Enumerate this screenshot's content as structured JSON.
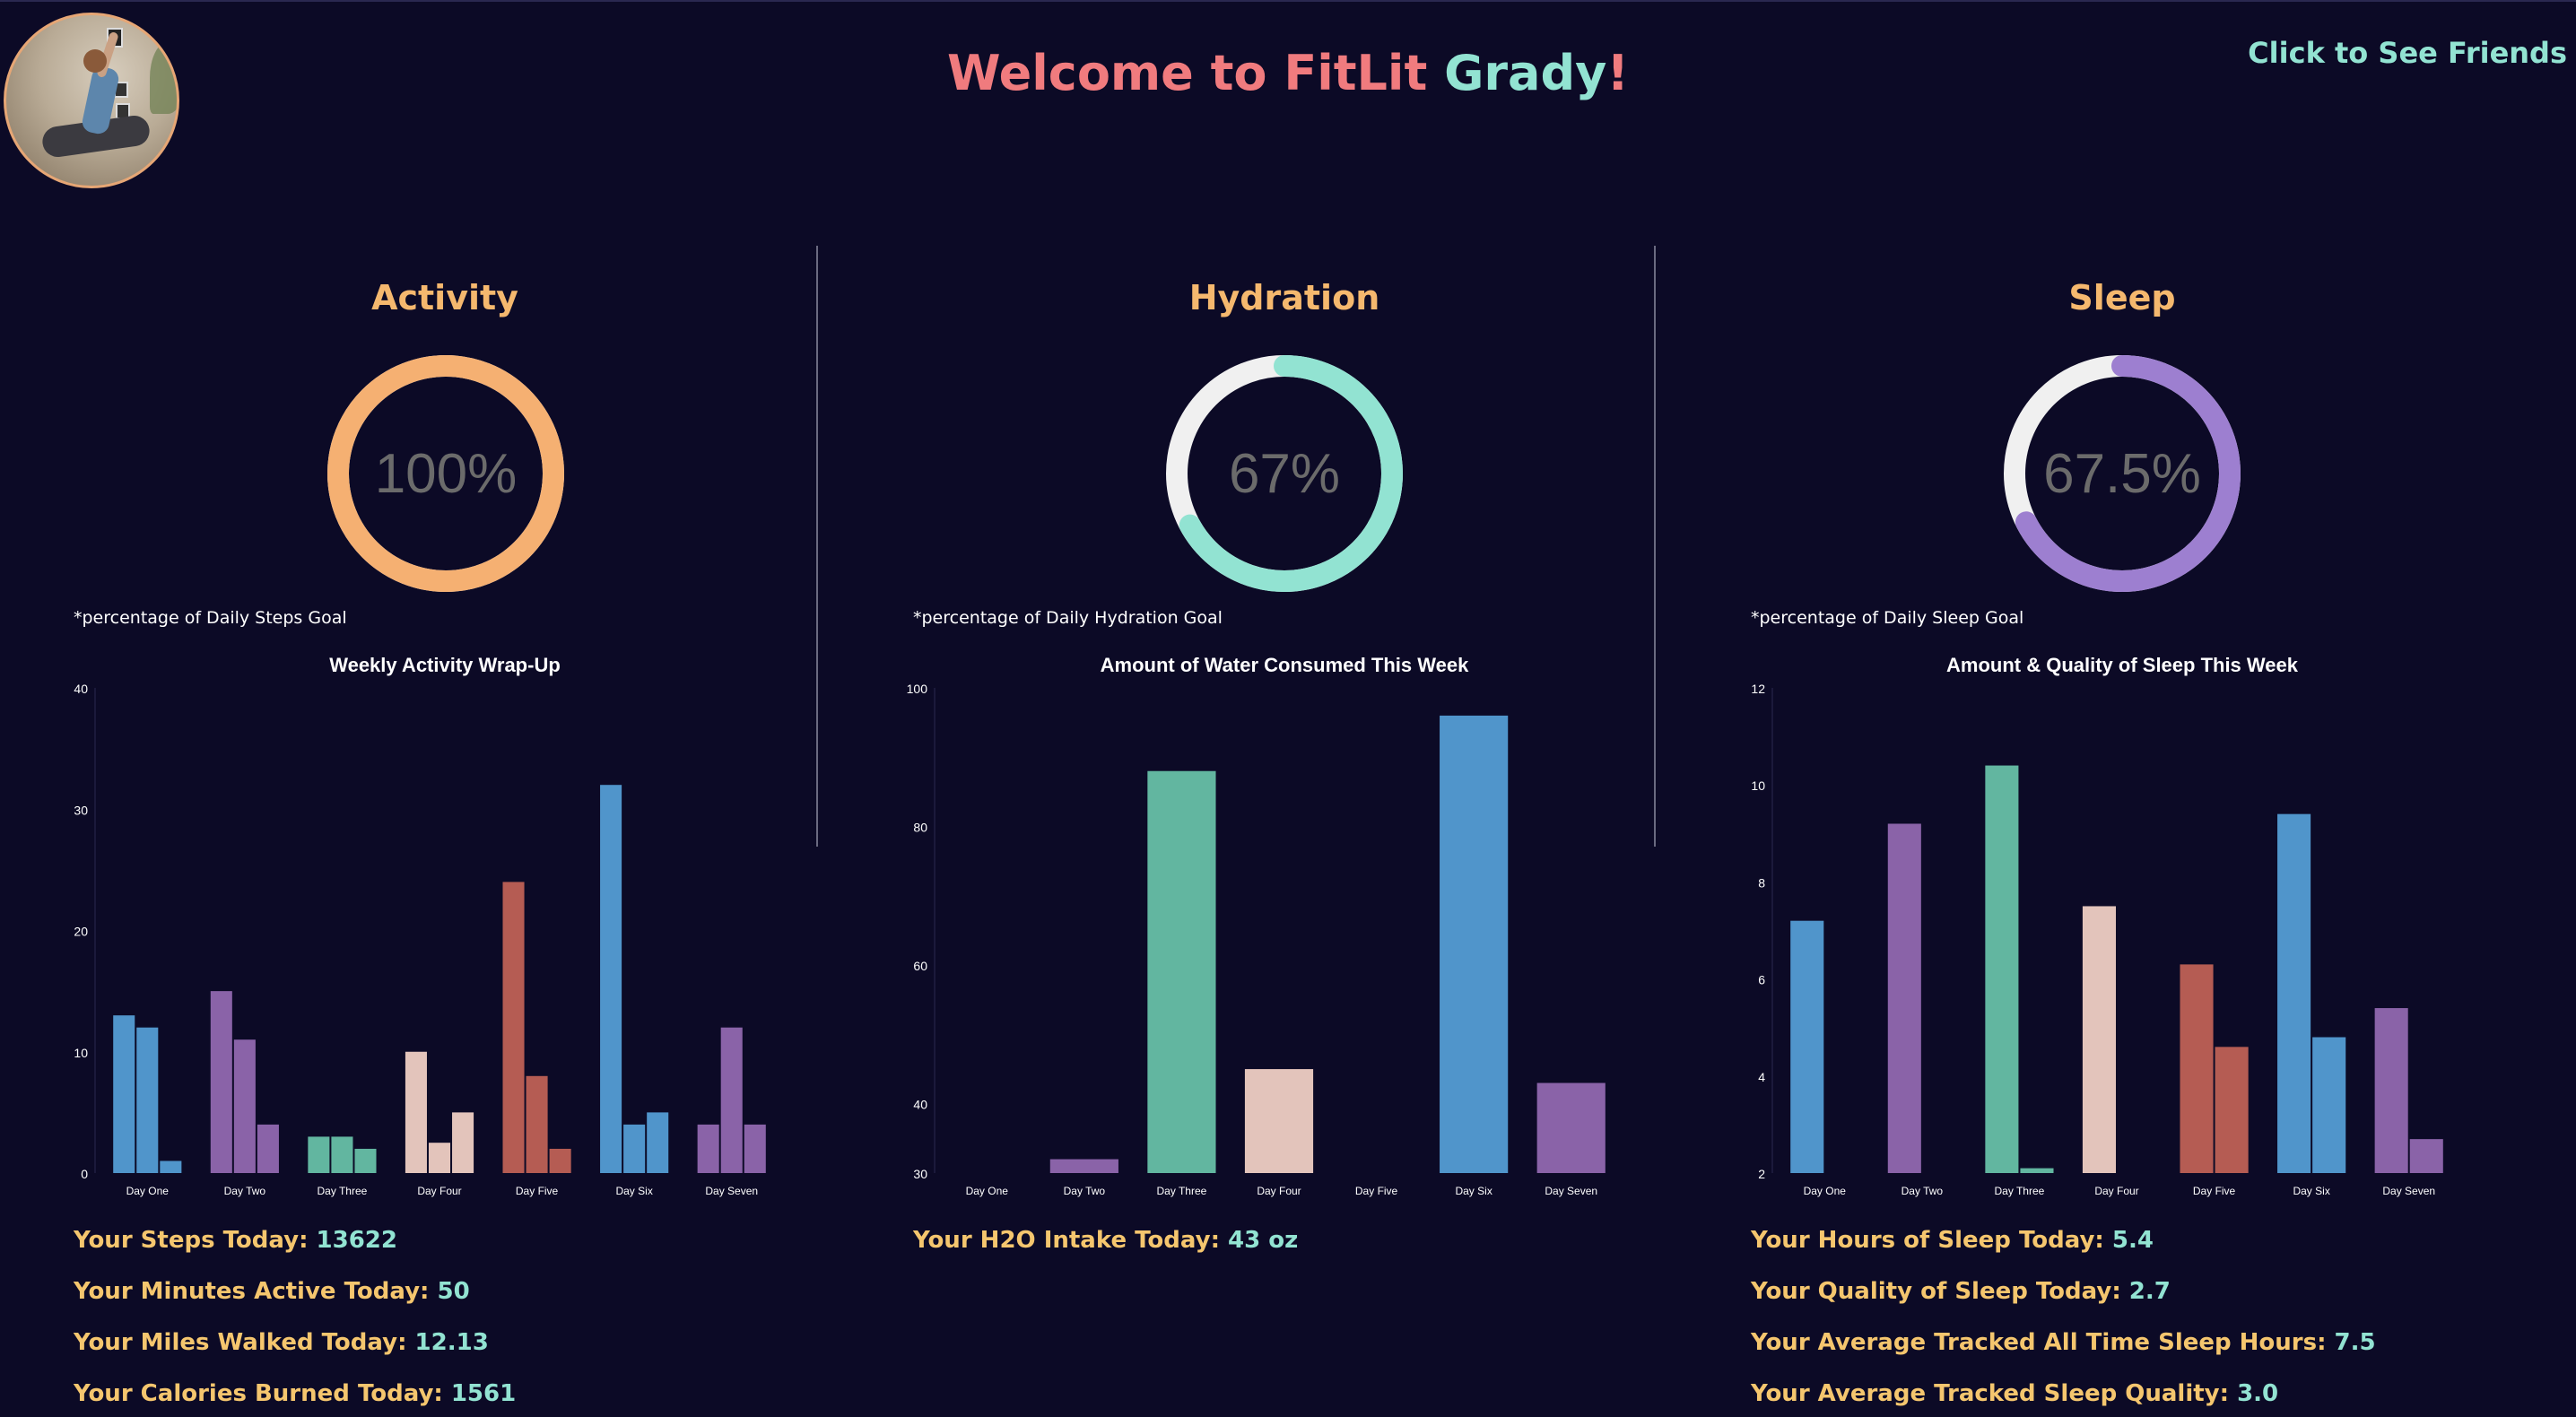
{
  "header": {
    "title_prefix": "Welcome to FitLit ",
    "user_name": "Grady",
    "title_suffix": "!",
    "friends_link": "Click to See Friends"
  },
  "colors": {
    "background": "#0c0a26",
    "title_welcome": "#f07b7e",
    "accent_teal": "#92e3d2",
    "section_title": "#f5b86e",
    "stat_label": "#f5c66e",
    "activity_ring": "#f5b072",
    "hydration_ring": "#92e3d2",
    "sleep_ring": "#9d7fd0",
    "ring_track": "#f0f0f0"
  },
  "sections": {
    "activity": {
      "title": "Activity",
      "percent_label": "100%",
      "percent_value": 100,
      "note": "*percentage of Daily Steps Goal"
    },
    "hydration": {
      "title": "Hydration",
      "percent_label": "67%",
      "percent_value": 67,
      "note": "*percentage of Daily Hydration Goal"
    },
    "sleep": {
      "title": "Sleep",
      "percent_label": "67.5%",
      "percent_value": 67.5,
      "note": "*percentage of Daily Sleep Goal"
    }
  },
  "stats": {
    "activity": [
      {
        "label": "Your Steps Today: ",
        "value": "13622"
      },
      {
        "label": "Your Minutes Active Today: ",
        "value": "50"
      },
      {
        "label": "Your Miles Walked Today: ",
        "value": "12.13"
      },
      {
        "label": "Your Calories Burned Today: ",
        "value": "1561"
      }
    ],
    "hydration": [
      {
        "label": "Your H2O Intake Today: ",
        "value": "43 oz"
      }
    ],
    "sleep": [
      {
        "label": "Your Hours of Sleep Today: ",
        "value": "5.4"
      },
      {
        "label": "Your Quality of Sleep Today: ",
        "value": "2.7"
      },
      {
        "label": "Your Average Tracked All Time Sleep Hours: ",
        "value": "7.5"
      },
      {
        "label": "Your Average Tracked Sleep Quality: ",
        "value": "3.0"
      }
    ]
  },
  "chart_data": [
    {
      "type": "bar",
      "title": "Weekly Activity Wrap-Up",
      "categories": [
        "Day One",
        "Day Two",
        "Day Three",
        "Day Four",
        "Day Five",
        "Day Six",
        "Day Seven"
      ],
      "ylim": [
        0,
        40
      ],
      "yticks": [
        0,
        10,
        20,
        30,
        40
      ],
      "bars_per_category": 3,
      "category_colors": [
        "#5095cb",
        "#8a63a8",
        "#62b6a0",
        "#e3c4bb",
        "#b55c53",
        "#5095cb",
        "#8a63a8"
      ],
      "values": [
        [
          13,
          12,
          1
        ],
        [
          15,
          11,
          4
        ],
        [
          3,
          3,
          2
        ],
        [
          10,
          2.5,
          5
        ],
        [
          24,
          8,
          2
        ],
        [
          32,
          4,
          5
        ],
        [
          4,
          12,
          4
        ]
      ]
    },
    {
      "type": "bar",
      "title": "Amount of Water Consumed This Week",
      "categories": [
        "Day One",
        "Day Two",
        "Day Three",
        "Day Four",
        "Day Five",
        "Day Six",
        "Day Seven"
      ],
      "ylim": [
        30,
        100
      ],
      "yticks": [
        30,
        40,
        60,
        80,
        100
      ],
      "bars_per_category": 1,
      "category_colors": [
        "#5095cb",
        "#8a63a8",
        "#62b6a0",
        "#e3c4bb",
        "#b55c53",
        "#5095cb",
        "#8a63a8"
      ],
      "values": [
        [
          30
        ],
        [
          32
        ],
        [
          88
        ],
        [
          45
        ],
        [
          30
        ],
        [
          96
        ],
        [
          43
        ]
      ]
    },
    {
      "type": "bar",
      "title": "Amount & Quality of Sleep This Week",
      "categories": [
        "Day One",
        "Day Two",
        "Day Three",
        "Day Four",
        "Day Five",
        "Day Six",
        "Day Seven"
      ],
      "ylim": [
        2,
        12
      ],
      "yticks": [
        2,
        4,
        6,
        8,
        10,
        12
      ],
      "bars_per_category": 2,
      "category_colors": [
        "#5095cb",
        "#8a63a8",
        "#62b6a0",
        "#e3c4bb",
        "#b55c53",
        "#5095cb",
        "#8a63a8"
      ],
      "values": [
        [
          7.2,
          2
        ],
        [
          9.2,
          2
        ],
        [
          10.4,
          2.1
        ],
        [
          7.5,
          2
        ],
        [
          6.3,
          4.6
        ],
        [
          9.4,
          4.8
        ],
        [
          5.4,
          2.7
        ]
      ]
    }
  ]
}
